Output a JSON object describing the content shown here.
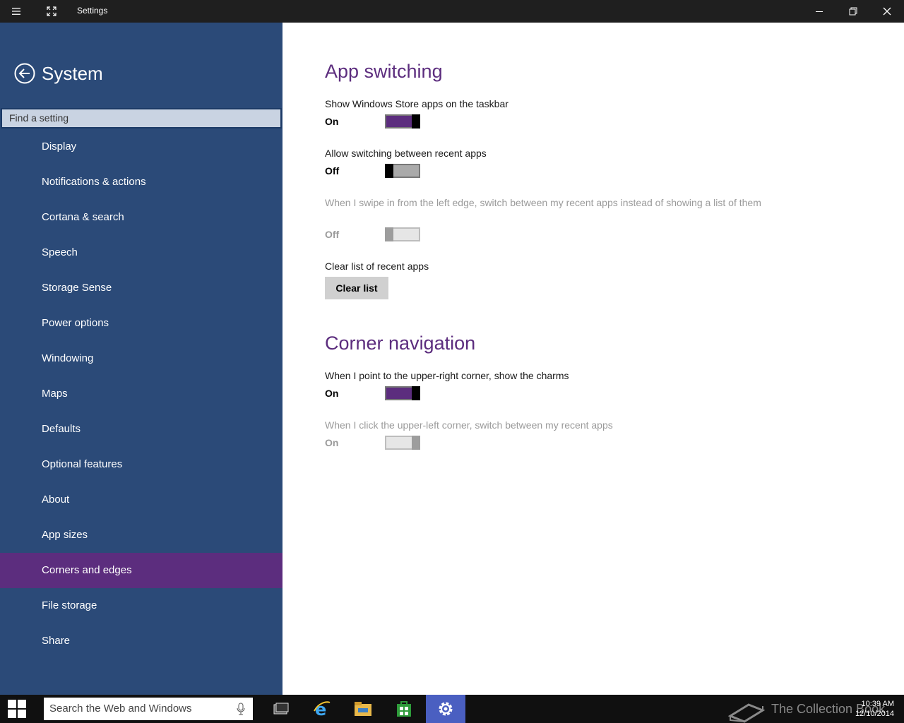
{
  "window": {
    "title": "Settings",
    "menu_icon": "hamburger-icon",
    "fullscreen_icon": "expand-icon",
    "minimize_icon": "minimize-icon",
    "restore_icon": "restore-icon",
    "close_icon": "close-icon"
  },
  "sidebar": {
    "title": "System",
    "back_icon": "back-arrow-icon",
    "search_placeholder": "Find a setting",
    "items": [
      {
        "label": "Display"
      },
      {
        "label": "Notifications & actions"
      },
      {
        "label": "Cortana & search"
      },
      {
        "label": "Speech"
      },
      {
        "label": "Storage Sense"
      },
      {
        "label": "Power options"
      },
      {
        "label": "Windowing"
      },
      {
        "label": "Maps"
      },
      {
        "label": "Defaults"
      },
      {
        "label": "Optional features"
      },
      {
        "label": "About"
      },
      {
        "label": "App sizes"
      },
      {
        "label": "Corners and edges",
        "active": true
      },
      {
        "label": "File storage"
      },
      {
        "label": "Share"
      }
    ],
    "colors": {
      "background": "#2b4a78",
      "active": "#5c2d7e"
    }
  },
  "main": {
    "app_switching": {
      "title": "App switching",
      "show_store_apps": {
        "label": "Show Windows Store apps on the taskbar",
        "state": "On"
      },
      "allow_switching": {
        "label": "Allow switching between recent apps",
        "state": "Off"
      },
      "swipe_left_edge": {
        "label": "When I swipe in from the left edge, switch between my recent apps instead of showing a list of them",
        "state": "Off",
        "disabled": true
      },
      "clear_list_label": "Clear list of recent apps",
      "clear_button": "Clear list"
    },
    "corner_navigation": {
      "title": "Corner navigation",
      "upper_right": {
        "label": "When I point to the upper-right corner, show the charms",
        "state": "On"
      },
      "upper_left": {
        "label": "When I click the upper-left corner, switch between my recent apps",
        "state": "On",
        "disabled": true
      }
    },
    "colors": {
      "accent": "#5c2d7e"
    }
  },
  "taskbar": {
    "start_icon": "windows-logo-icon",
    "search_placeholder": "Search the Web and Windows",
    "mic_icon": "microphone-icon",
    "apps": [
      {
        "icon": "task-view-icon"
      },
      {
        "icon": "internet-explorer-icon"
      },
      {
        "icon": "file-explorer-icon"
      },
      {
        "icon": "store-icon"
      },
      {
        "icon": "settings-gear-icon",
        "active": true
      }
    ],
    "watermark": "The Collection Book",
    "time": "10:39 AM",
    "date": "12/10/2014"
  }
}
